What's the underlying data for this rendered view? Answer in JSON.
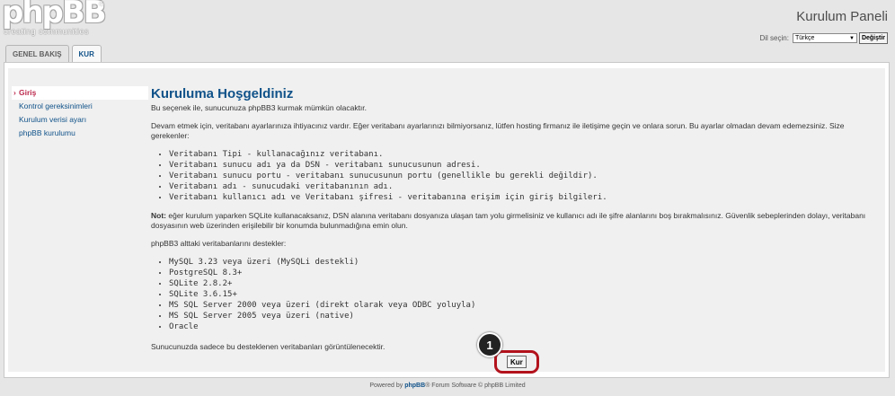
{
  "header": {
    "logo_text": "phpBB",
    "logo_reg": "®",
    "logo_tagline": "creating communities",
    "panel_title": "Kurulum Paneli",
    "language_label": "Dil seçin:",
    "language_selected": "Türkçe",
    "language_button": "Değiştir"
  },
  "tabs": [
    {
      "label": "GENEL BAKIŞ",
      "active": false
    },
    {
      "label": "KUR",
      "active": true
    }
  ],
  "sidebar": {
    "items": [
      {
        "label": "Giriş",
        "active": true
      },
      {
        "label": "Kontrol gereksinimleri",
        "active": false
      },
      {
        "label": "Kurulum verisi ayarı",
        "active": false
      },
      {
        "label": "phpBB kurulumu",
        "active": false
      }
    ]
  },
  "content": {
    "title": "Kuruluma Hoşgeldiniz",
    "intro": "Bu seçenek ile, sunucunuza phpBB3 kurmak mümkün olacaktır.",
    "requirements_text": "Devam etmek için, veritabanı ayarlarınıza ihtiyacınız vardır. Eğer veritabanı ayarlarınızı bilmiyorsanız, lütfen hosting firmanız ile iletişime geçin ve onlara sorun. Bu ayarlar olmadan devam edemezsiniz. Size gerekenler:",
    "requirements": [
      "Veritabanı Tipi - kullanacağınız veritabanı.",
      "Veritabanı sunucu adı ya da DSN - veritabanı sunucusunun adresi.",
      "Veritabanı sunucu portu - veritabanı sunucusunun portu (genellikle bu gerekli değildir).",
      "Veritabanı adı - sunucudaki veritabanının adı.",
      "Veritabanı kullanıcı adı ve Veritabanı şifresi - veritabanına erişim için giriş bilgileri."
    ],
    "note_label": "Not:",
    "note_text": " eğer kurulum yaparken SQLite kullanacaksanız, DSN alanına veritabanı dosyanıza ulaşan tam yolu girmelisiniz ve kullanıcı adı ile şifre alanlarını boş bırakmalısınız. Güvenlik sebeplerinden dolayı, veritabanı dosyasının web üzerinden erişilebilir bir konumda bulunmadığına emin olun.",
    "supports_text": "phpBB3 alttaki veritabanlarını destekler:",
    "databases": [
      "MySQL 3.23 veya üzeri (MySQLi destekli)",
      "PostgreSQL 8.3+",
      "SQLite 2.8.2+",
      "SQLite 3.6.15+",
      "MS SQL Server 2000 veya üzeri (direkt olarak veya ODBC yoluyla)",
      "MS SQL Server 2005 veya üzeri (native)",
      "Oracle"
    ],
    "closing_text": "Sunucunuzda sadece bu desteklenen veritabanları görüntülenecektir.",
    "install_button": "Kur"
  },
  "callout": {
    "number": "1"
  },
  "footer": {
    "prefix": "Powered by ",
    "brand": "phpBB",
    "suffix": "® Forum Software © phpBB Limited"
  },
  "colors": {
    "link": "#105289",
    "active": "#bc2a4d",
    "highlight": "#b2121c"
  }
}
